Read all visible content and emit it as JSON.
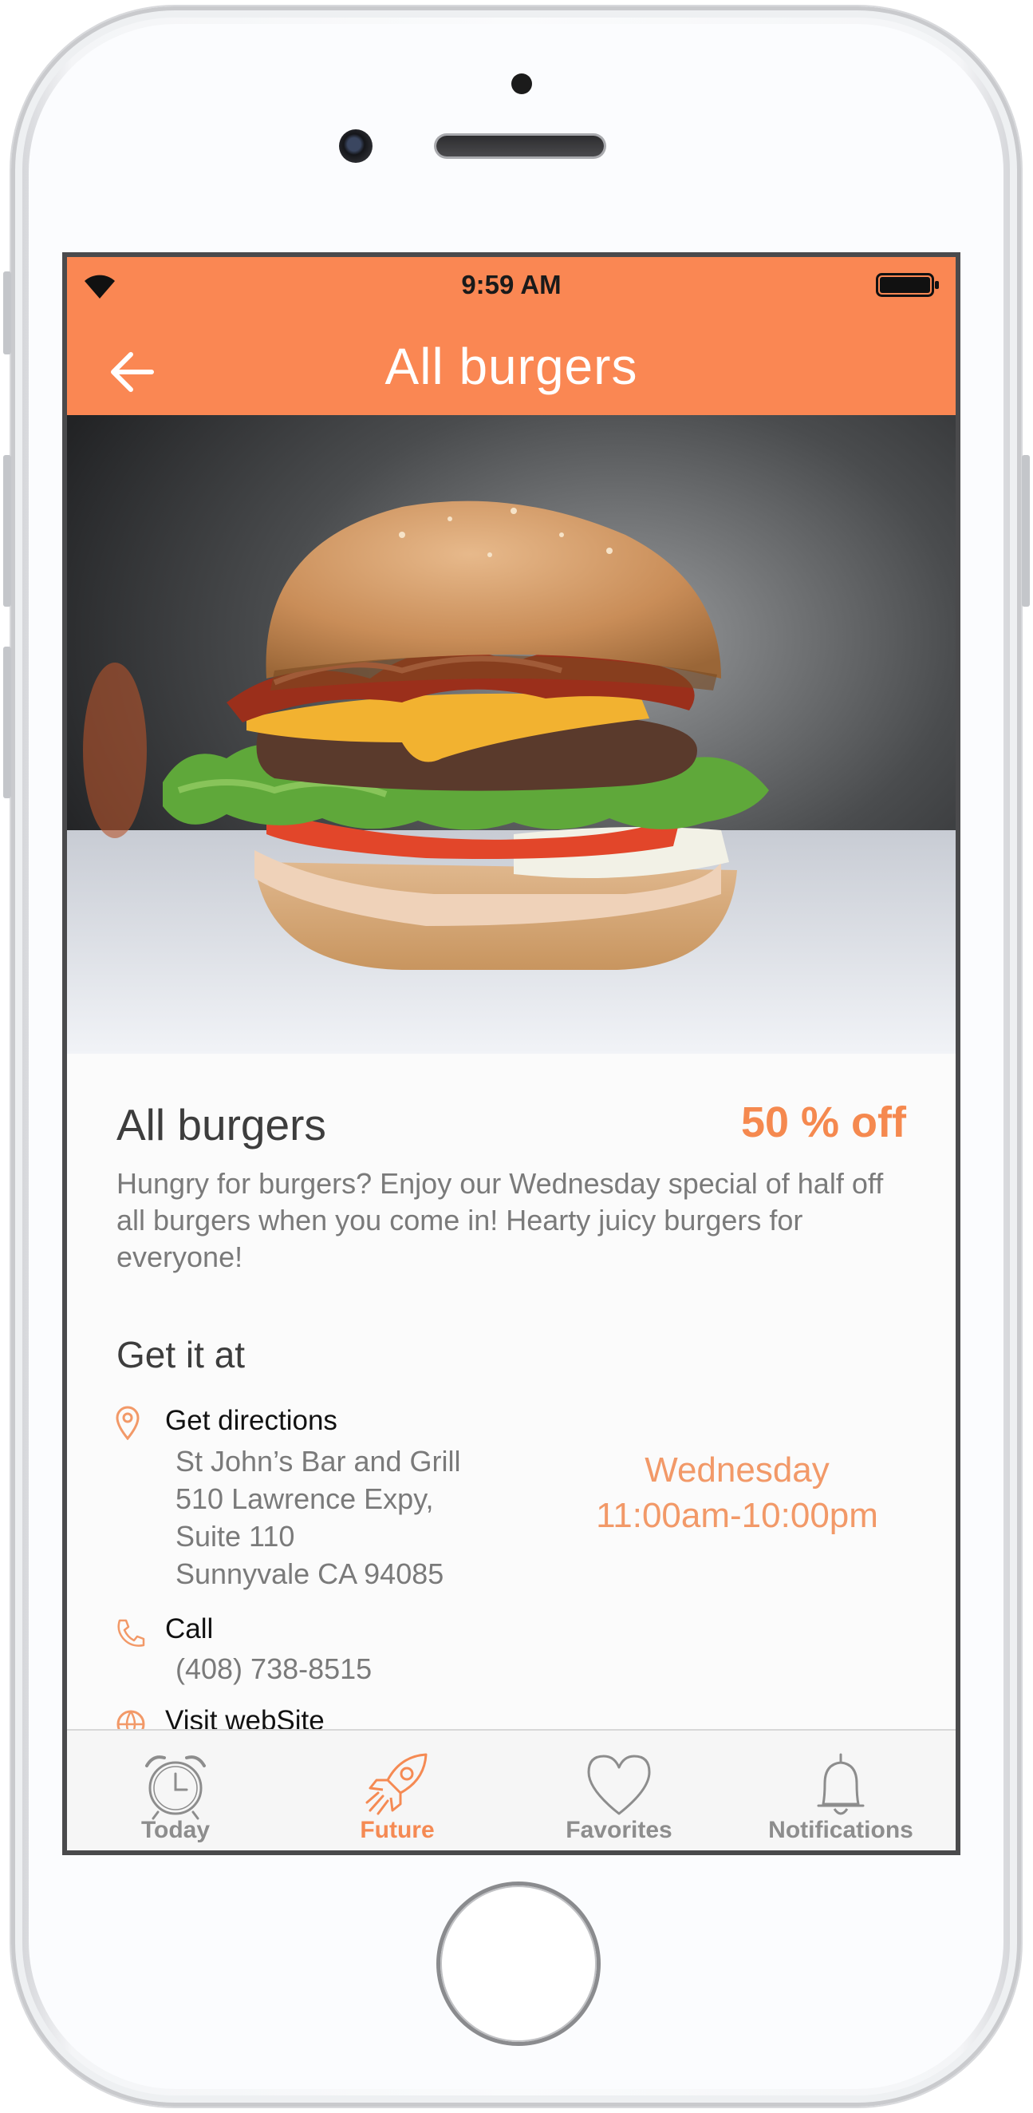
{
  "status_bar": {
    "time": "9:59 AM"
  },
  "nav": {
    "title": "All burgers"
  },
  "hero": {
    "description": "burger photo"
  },
  "deal": {
    "title": "All burgers",
    "discount": "50 % off",
    "description": "Hungry for burgers? Enjoy our Wednesday special of half off all burgers when you come in! Hearty juicy burgers for everyone!"
  },
  "location": {
    "heading": "Get it at",
    "directions_label": "Get directions",
    "address_lines": [
      "St John’s Bar and Grill",
      "510 Lawrence Expy,",
      "Suite 110",
      "Sunnyvale CA 94085"
    ],
    "day": "Wednesday",
    "hours": "11:00am-10:00pm",
    "call_label": "Call",
    "phone": "(408) 738-8515",
    "website_label": "Visit webSite"
  },
  "tabs": [
    {
      "label": "Today",
      "icon": "alarm-clock-icon",
      "active": false
    },
    {
      "label": "Future",
      "icon": "rocket-icon",
      "active": true
    },
    {
      "label": "Favorites",
      "icon": "heart-icon",
      "active": false
    },
    {
      "label": "Notifications",
      "icon": "bell-icon",
      "active": false
    }
  ],
  "colors": {
    "accent": "#fa8753",
    "accent_text": "#f5894f",
    "active_tab": "#f58a53"
  }
}
